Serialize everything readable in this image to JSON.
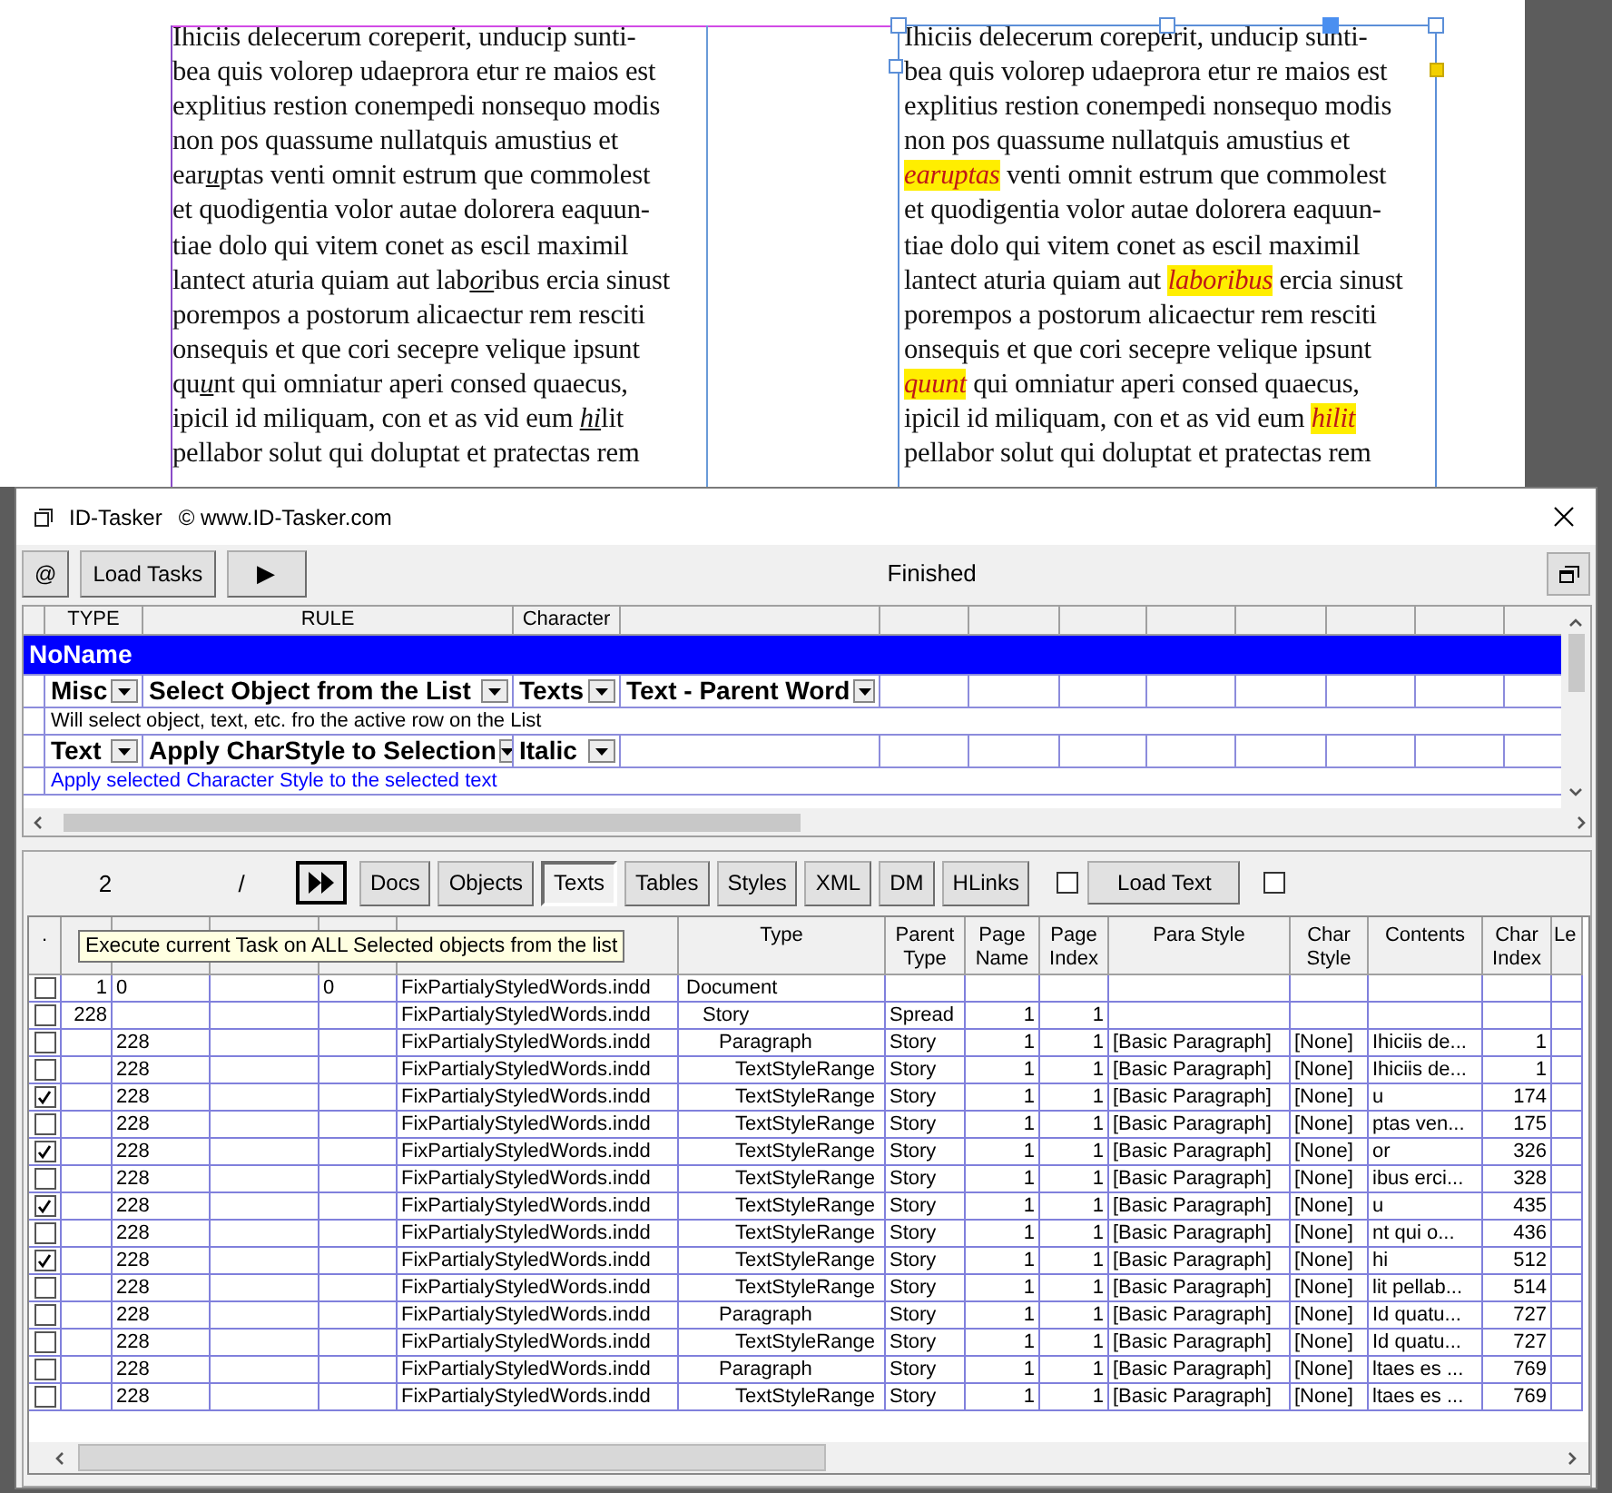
{
  "document": {
    "columns": [
      {
        "kind": "underline",
        "lines": [
          [
            "Ihiciis delecerum coreperit, unducip sunti-"
          ],
          [
            "bea quis volorep udaeprora etur re maios est"
          ],
          [
            "explitius restion conempedi nonsequo modis"
          ],
          [
            "non pos quassume nullatquis amustius et"
          ],
          [
            {
              "text": "ear",
              "marked": false
            },
            {
              "text": "u",
              "marked": true
            },
            {
              "text": "ptas venti omnit estrum que commolest",
              "marked": false
            }
          ],
          [
            "et quodigentia volor autae dolorera eaquun-"
          ],
          [
            "tiae dolo qui vitem conet as escil maximil"
          ],
          [
            {
              "text": "lantect aturia quiam aut lab",
              "marked": false
            },
            {
              "text": "or",
              "marked": true
            },
            {
              "text": "ibus ercia sinust",
              "marked": false
            }
          ],
          [
            "porempos a postorum alicaectur rem resciti"
          ],
          [
            "onsequis et que cori secepre velique ipsunt"
          ],
          [
            {
              "text": "qu",
              "marked": false
            },
            {
              "text": "u",
              "marked": true
            },
            {
              "text": "nt qui omniatur aperi consed quaecus,",
              "marked": false
            }
          ],
          [
            {
              "text": "ipicil id miliquam, con et as vid eum ",
              "marked": false
            },
            {
              "text": "hi",
              "marked": true
            },
            {
              "text": "lit",
              "marked": false
            }
          ],
          [
            "pellabor solut qui doluptat et pratectas rem"
          ]
        ]
      },
      {
        "kind": "highlight",
        "lines": [
          [
            "Ihiciis delecerum coreperit, unducip sunti-"
          ],
          [
            "bea quis volorep udaeprora etur re maios est"
          ],
          [
            "explitius restion conempedi nonsequo modis"
          ],
          [
            "non pos quassume nullatquis amustius et"
          ],
          [
            {
              "text": "earuptas",
              "marked": true
            },
            {
              "text": " venti omnit estrum que commolest",
              "marked": false
            }
          ],
          [
            "et quodigentia volor autae dolorera eaquun-"
          ],
          [
            "tiae dolo qui vitem conet as escil maximil"
          ],
          [
            {
              "text": "lantect aturia quiam aut ",
              "marked": false
            },
            {
              "text": "laboribus",
              "marked": true
            },
            {
              "text": " ercia sinust",
              "marked": false
            }
          ],
          [
            "porempos a postorum alicaectur rem resciti"
          ],
          [
            "onsequis et que cori secepre velique ipsunt"
          ],
          [
            {
              "text": "quunt",
              "marked": true
            },
            {
              "text": " qui omniatur aperi consed quaecus,",
              "marked": false
            }
          ],
          [
            {
              "text": "ipicil id miliquam, con et as vid eum ",
              "marked": false
            },
            {
              "text": "hilit",
              "marked": true
            }
          ],
          [
            "pellabor solut qui doluptat et pratectas rem"
          ]
        ]
      }
    ]
  },
  "window": {
    "title": "ID-Tasker",
    "copyright": "© www.ID-Tasker.com",
    "toolbar": {
      "buttons": [
        {
          "label": "@"
        },
        {
          "label": "Load Tasks"
        },
        {
          "label": "▶"
        }
      ],
      "status": "Finished"
    },
    "task_grid": {
      "columns": [
        "TYPE",
        "RULE",
        "Character"
      ],
      "group": "NoName",
      "tasks": [
        {
          "type": "Misc",
          "rule": "Select Object from the List",
          "character": "Texts",
          "parameter": "Text - Parent Word",
          "description": "Will select object, text, etc. fro the active row on the List",
          "color": "#000000"
        },
        {
          "type": "Text",
          "rule": "Apply CharStyle to Selection",
          "character": "Italic",
          "description": "Apply selected Character Style to the selected text",
          "color": "#0000ff"
        }
      ]
    },
    "object_panel": {
      "counter": "2",
      "separator": "/",
      "tabs": [
        {
          "label": "Docs",
          "selected": false
        },
        {
          "label": "Objects",
          "selected": false
        },
        {
          "label": "Texts",
          "selected": true
        },
        {
          "label": "Tables",
          "selected": false
        },
        {
          "label": "Styles",
          "selected": false
        },
        {
          "label": "XML",
          "selected": false
        },
        {
          "label": "DM",
          "selected": false
        },
        {
          "label": "HLinks",
          "selected": false
        }
      ],
      "checkboxes": [
        {
          "checked": false
        },
        {
          "checked": false
        }
      ],
      "load_text": "Load Text",
      "tooltip": "Execute current Task on ALL Selected objects from the list",
      "columns": [
        ".",
        "Type",
        "Parent Type",
        "Page Name",
        "Page Index",
        "Para Style",
        "Char Style",
        "Contents",
        "Char Index",
        "Le"
      ],
      "rows": [
        {
          "checked": false,
          "id": "1",
          "parent_id": "0",
          "parent": "0",
          "indd_doc": "FixPartialyStyledWords.indd",
          "type": "Document",
          "children": [
            {
              "checked": false,
              "id": "228",
              "indd_doc": "FixPartialyStyledWords.indd",
              "type": "Story",
              "parent_type": "Spread",
              "page_name": "1",
              "page_index": "1",
              "children": [
                {
                  "checked": false,
                  "parent_id": "228",
                  "indd_doc": "FixPartialyStyledWords.indd",
                  "type": "Paragraph",
                  "parent_type": "Story",
                  "page_name": "1",
                  "page_index": "1",
                  "para_style": "[Basic Paragraph]",
                  "char_style": "[None]",
                  "contents": "Ihiciis de...",
                  "char_index": "1",
                  "children": [
                    {
                      "checked": false,
                      "parent_id": "228",
                      "indd_doc": "FixPartialyStyledWords.indd",
                      "type": "TextStyleRange",
                      "parent_type": "Story",
                      "page_name": "1",
                      "page_index": "1",
                      "para_style": "[Basic Paragraph]",
                      "char_style": "[None]",
                      "contents": "Ihiciis de...",
                      "char_index": "1"
                    },
                    {
                      "checked": true,
                      "parent_id": "228",
                      "indd_doc": "FixPartialyStyledWords.indd",
                      "type": "TextStyleRange",
                      "parent_type": "Story",
                      "page_name": "1",
                      "page_index": "1",
                      "para_style": "[Basic Paragraph]",
                      "char_style": "[None]",
                      "contents": "u",
                      "char_index": "174"
                    },
                    {
                      "checked": false,
                      "parent_id": "228",
                      "indd_doc": "FixPartialyStyledWords.indd",
                      "type": "TextStyleRange",
                      "parent_type": "Story",
                      "page_name": "1",
                      "page_index": "1",
                      "para_style": "[Basic Paragraph]",
                      "char_style": "[None]",
                      "contents": "ptas ven...",
                      "char_index": "175"
                    },
                    {
                      "checked": true,
                      "parent_id": "228",
                      "indd_doc": "FixPartialyStyledWords.indd",
                      "type": "TextStyleRange",
                      "parent_type": "Story",
                      "page_name": "1",
                      "page_index": "1",
                      "para_style": "[Basic Paragraph]",
                      "char_style": "[None]",
                      "contents": "or",
                      "char_index": "326"
                    },
                    {
                      "checked": false,
                      "parent_id": "228",
                      "indd_doc": "FixPartialyStyledWords.indd",
                      "type": "TextStyleRange",
                      "parent_type": "Story",
                      "page_name": "1",
                      "page_index": "1",
                      "para_style": "[Basic Paragraph]",
                      "char_style": "[None]",
                      "contents": "ibus erci...",
                      "char_index": "328"
                    },
                    {
                      "checked": true,
                      "parent_id": "228",
                      "indd_doc": "FixPartialyStyledWords.indd",
                      "type": "TextStyleRange",
                      "parent_type": "Story",
                      "page_name": "1",
                      "page_index": "1",
                      "para_style": "[Basic Paragraph]",
                      "char_style": "[None]",
                      "contents": "u",
                      "char_index": "435"
                    },
                    {
                      "checked": false,
                      "parent_id": "228",
                      "indd_doc": "FixPartialyStyledWords.indd",
                      "type": "TextStyleRange",
                      "parent_type": "Story",
                      "page_name": "1",
                      "page_index": "1",
                      "para_style": "[Basic Paragraph]",
                      "char_style": "[None]",
                      "contents": "nt qui o...",
                      "char_index": "436"
                    },
                    {
                      "checked": true,
                      "parent_id": "228",
                      "indd_doc": "FixPartialyStyledWords.indd",
                      "type": "TextStyleRange",
                      "parent_type": "Story",
                      "page_name": "1",
                      "page_index": "1",
                      "para_style": "[Basic Paragraph]",
                      "char_style": "[None]",
                      "contents": "hi",
                      "char_index": "512"
                    },
                    {
                      "checked": false,
                      "parent_id": "228",
                      "indd_doc": "FixPartialyStyledWords.indd",
                      "type": "TextStyleRange",
                      "parent_type": "Story",
                      "page_name": "1",
                      "page_index": "1",
                      "para_style": "[Basic Paragraph]",
                      "char_style": "[None]",
                      "contents": "lit pellab...",
                      "char_index": "514"
                    }
                  ]
                },
                {
                  "checked": false,
                  "parent_id": "228",
                  "indd_doc": "FixPartialyStyledWords.indd",
                  "type": "Paragraph",
                  "parent_type": "Story",
                  "page_name": "1",
                  "page_index": "1",
                  "para_style": "[Basic Paragraph]",
                  "char_style": "[None]",
                  "contents": "Id quatu...",
                  "char_index": "727",
                  "children": [
                    {
                      "checked": false,
                      "parent_id": "228",
                      "indd_doc": "FixPartialyStyledWords.indd",
                      "type": "TextStyleRange",
                      "parent_type": "Story",
                      "page_name": "1",
                      "page_index": "1",
                      "para_style": "[Basic Paragraph]",
                      "char_style": "[None]",
                      "contents": "Id quatu...",
                      "char_index": "727"
                    }
                  ]
                },
                {
                  "checked": false,
                  "parent_id": "228",
                  "indd_doc": "FixPartialyStyledWords.indd",
                  "type": "Paragraph",
                  "parent_type": "Story",
                  "page_name": "1",
                  "page_index": "1",
                  "para_style": "[Basic Paragraph]",
                  "char_style": "[None]",
                  "contents": "ltaes es ...",
                  "char_index": "769",
                  "children": [
                    {
                      "checked": false,
                      "parent_id": "228",
                      "indd_doc": "FixPartialyStyledWords.indd",
                      "type": "TextStyleRange",
                      "parent_type": "Story",
                      "page_name": "1",
                      "page_index": "1",
                      "para_style": "[Basic Paragraph]",
                      "char_style": "[None]",
                      "contents": "ltaes es ...",
                      "char_index": "769"
                    }
                  ]
                }
              ]
            }
          ]
        }
      ]
    }
  }
}
